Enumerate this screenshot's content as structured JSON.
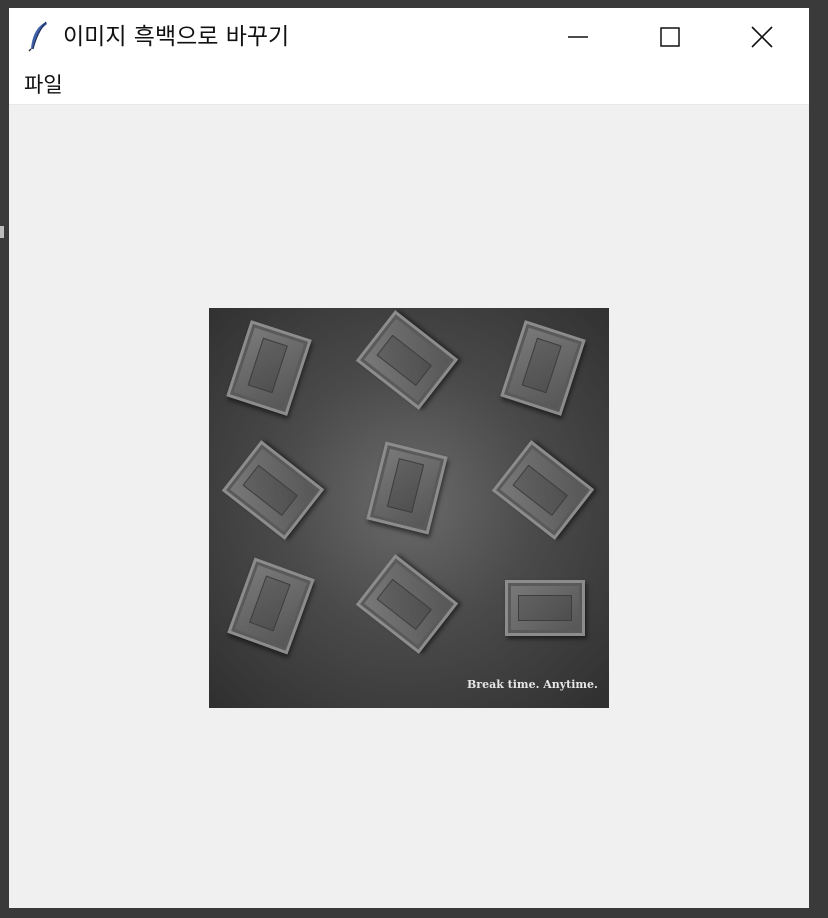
{
  "window": {
    "title": "이미지 흑백으로 바꾸기"
  },
  "menu": {
    "items": [
      {
        "label": "파일"
      }
    ]
  },
  "image": {
    "tagline": "Break time. Anytime."
  }
}
